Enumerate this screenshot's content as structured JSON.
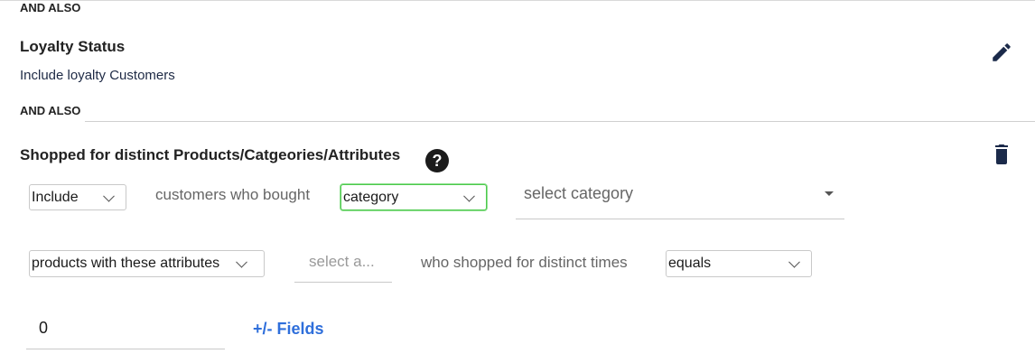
{
  "sections": {
    "and_also_top": "AND ALSO",
    "loyalty": {
      "title": "Loyalty Status",
      "subtitle": "Include loyalty Customers",
      "edit_icon": "pencil-icon"
    },
    "and_also_mid": "AND ALSO",
    "shopped": {
      "title": "Shopped for distinct Products/Catgeories/Attributes",
      "help_icon": "question-circle-icon",
      "help_glyph": "?",
      "delete_icon": "trash-icon",
      "row1": {
        "include_select": "Include",
        "customers_text": "customers who bought",
        "type_select": "category",
        "category_dropdown": "select category"
      },
      "row2": {
        "attributes_select": "products with these attributes",
        "attribute_placeholder": "select a...",
        "shopped_text": "who shopped for distinct times",
        "comparator_select": "equals"
      },
      "row3": {
        "count_value": "0",
        "fields_link": "+/- Fields"
      }
    }
  },
  "colors": {
    "link": "#2f6fdb",
    "focus_border": "#4cc94c",
    "icon": "#1b2a4a"
  }
}
